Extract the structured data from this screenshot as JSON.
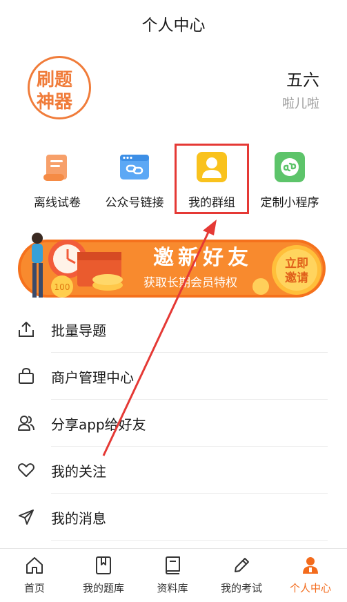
{
  "header": {
    "title": "个人中心"
  },
  "logo": {
    "text_top": "刷题",
    "text_bottom": "神器",
    "alt": "刷题神器"
  },
  "user": {
    "name": "五六",
    "subtitle": "啦儿啦"
  },
  "quick_actions": [
    {
      "label": "离线试卷",
      "icon": "scroll-doc-icon"
    },
    {
      "label": "公众号链接",
      "icon": "link-browser-icon"
    },
    {
      "label": "我的群组",
      "icon": "user-avatar-icon"
    },
    {
      "label": "定制小程序",
      "icon": "mini-program-icon"
    }
  ],
  "banner": {
    "title": "邀新好友",
    "subtitle": "获取长期会员特权",
    "button": "立即\n邀请",
    "button_line1": "立即",
    "button_line2": "邀请",
    "coin": "100"
  },
  "menu": [
    {
      "label": "批量导题",
      "icon": "upload-icon"
    },
    {
      "label": "商户管理中心",
      "icon": "shopping-bag-icon"
    },
    {
      "label": "分享app给好友",
      "icon": "users-share-icon"
    },
    {
      "label": "我的关注",
      "icon": "heart-icon"
    },
    {
      "label": "我的消息",
      "icon": "send-icon"
    }
  ],
  "tabs": [
    {
      "label": "首页",
      "icon": "home-icon",
      "active": false
    },
    {
      "label": "我的题库",
      "icon": "bookmark-book-icon",
      "active": false
    },
    {
      "label": "资料库",
      "icon": "book-icon",
      "active": false
    },
    {
      "label": "我的考试",
      "icon": "pencil-icon",
      "active": false
    },
    {
      "label": "个人中心",
      "icon": "person-icon",
      "active": true
    }
  ],
  "colors": {
    "accent": "#f36b1c",
    "highlight": "#e53935",
    "banner_orange": "#f5711c"
  }
}
